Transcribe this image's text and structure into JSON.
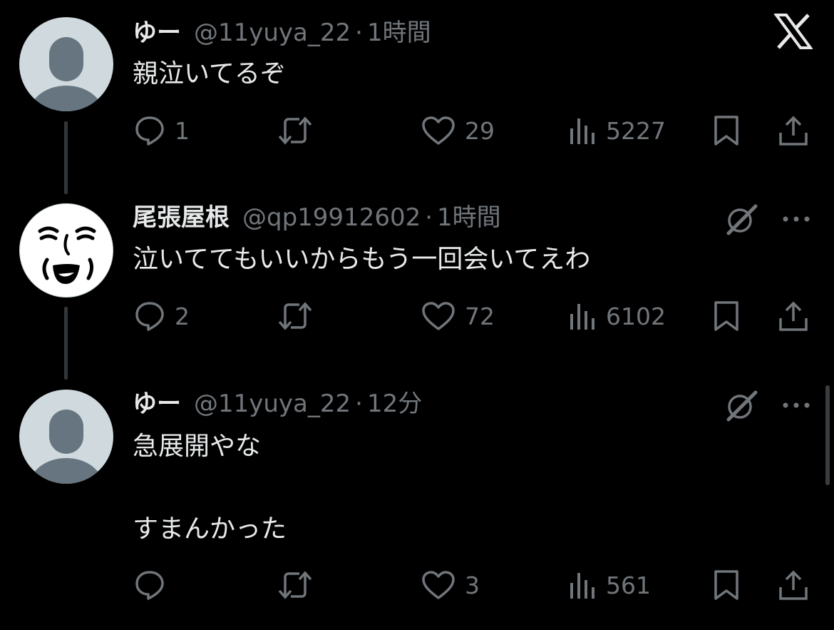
{
  "brand": {
    "logo_icon": "x-logo-icon"
  },
  "colors": {
    "background": "#000000",
    "text": "#e7e9ea",
    "muted": "#71767b",
    "thread_line": "#333639",
    "avatar_bg": "#cfd9de"
  },
  "tweets": [
    {
      "name": "ゆー",
      "handle": "@11yuya_22",
      "separator": "·",
      "time": "1時間",
      "lines": [
        "親泣いてるぞ"
      ],
      "replies": "1",
      "retweets": "",
      "likes": "29",
      "views": "5227"
    },
    {
      "name": "尾張屋根",
      "handle": "@qp19912602",
      "separator": "·",
      "time": "1時間",
      "lines": [
        "泣いててもいいからもう一回会いてえわ"
      ],
      "replies": "2",
      "retweets": "",
      "likes": "72",
      "views": "6102"
    },
    {
      "name": "ゆー",
      "handle": "@11yuya_22",
      "separator": "·",
      "time": "12分",
      "lines": [
        "急展開やな",
        "",
        "すまんかった"
      ],
      "replies": "",
      "retweets": "",
      "likes": "3",
      "views": "561"
    }
  ]
}
